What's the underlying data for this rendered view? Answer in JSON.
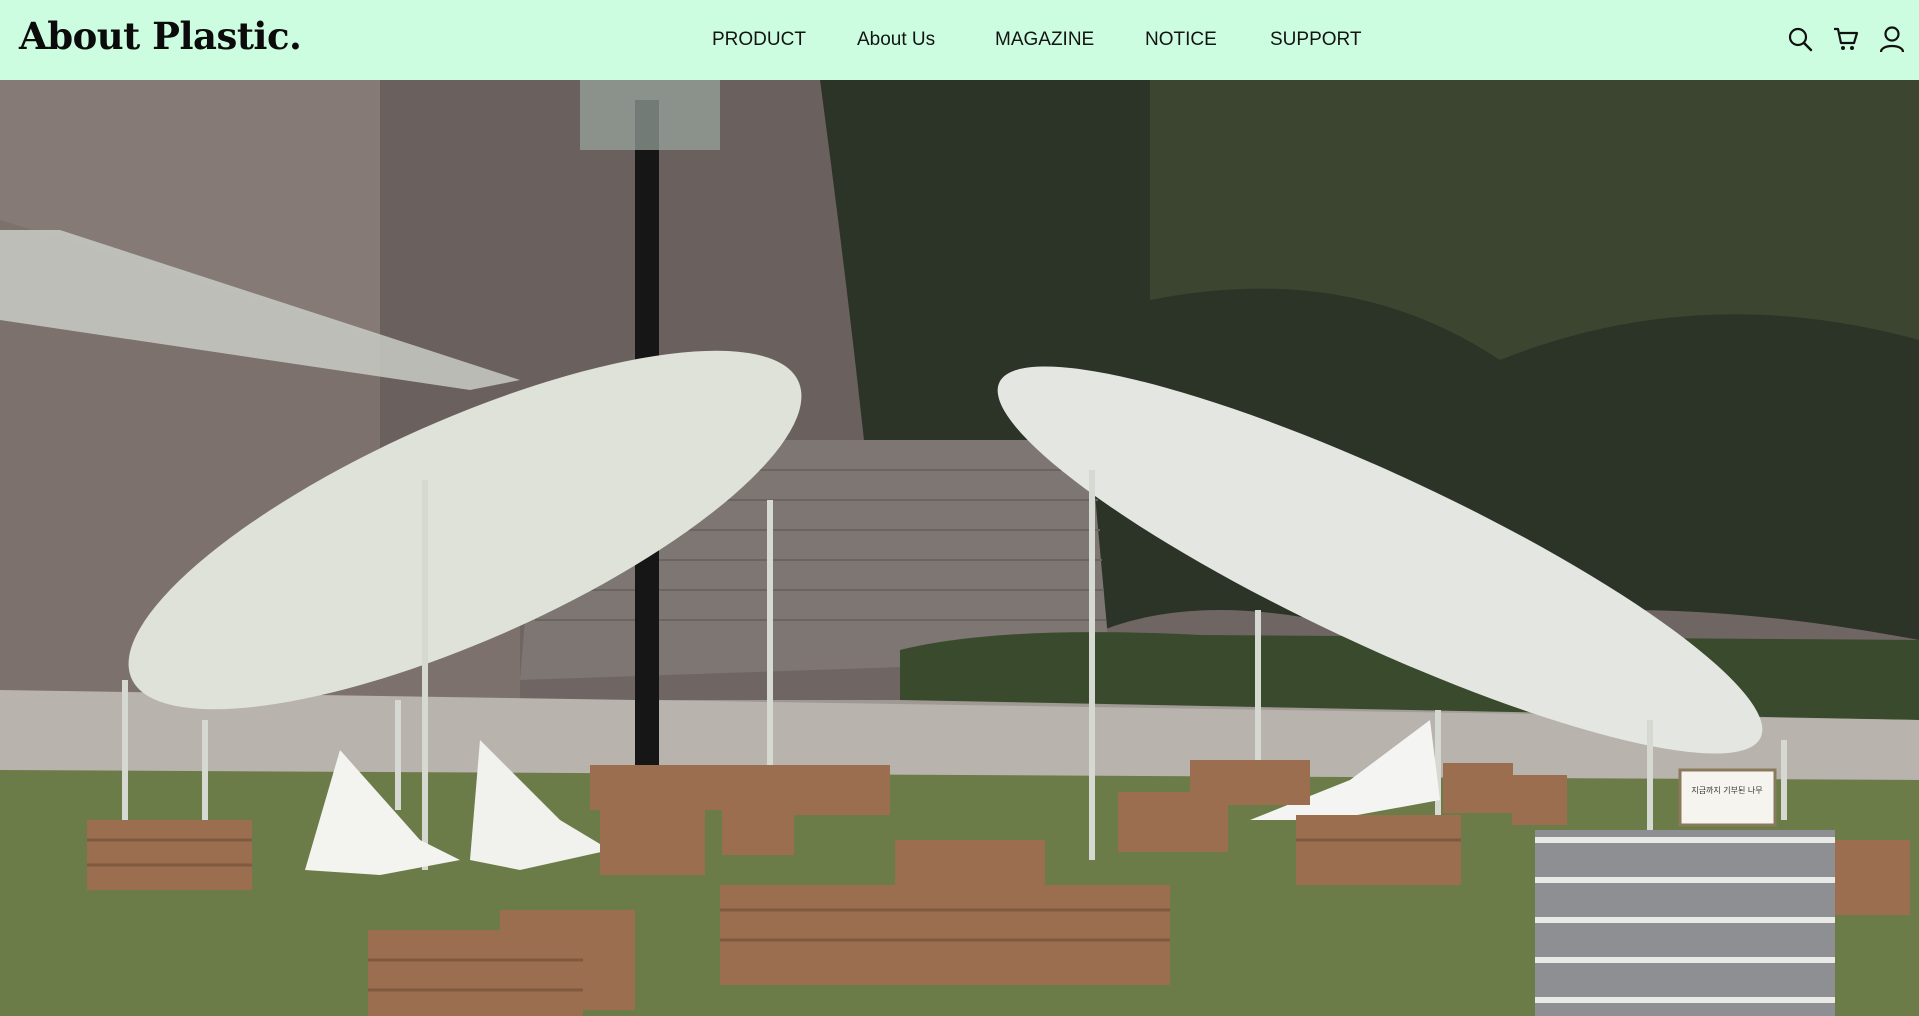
{
  "brand": {
    "logo_text": "About Plastic."
  },
  "nav": {
    "items": [
      {
        "label": "PRODUCT"
      },
      {
        "label": "About Us"
      },
      {
        "label": "MAGAZINE"
      },
      {
        "label": "NOTICE"
      },
      {
        "label": "SUPPORT"
      }
    ]
  },
  "header_icons": [
    "search-icon",
    "cart-icon",
    "user-icon"
  ],
  "colors": {
    "header_bg": "#ccfde0",
    "text": "#141414"
  },
  "hero": {
    "sign_text": "지금까지 기부된 나무"
  }
}
